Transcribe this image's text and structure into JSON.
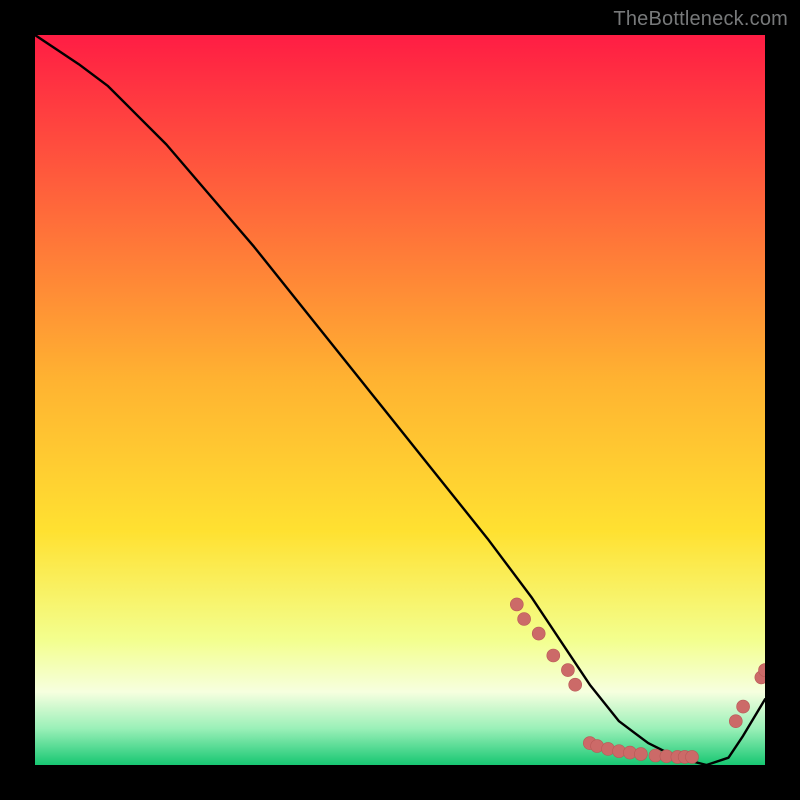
{
  "attribution": "TheBottleneck.com",
  "colors": {
    "curve": "#000000",
    "marker_fill": "#cc6a68",
    "marker_stroke": "#b85957",
    "gradient_top": "#ff1d44",
    "gradient_yellow": "#ffe131",
    "gradient_pale": "#f6ffdf",
    "gradient_green": "#2de38a",
    "gradient_bottom": "#17c772"
  },
  "chart_data": {
    "type": "line",
    "title": "",
    "xlabel": "",
    "ylabel": "",
    "xlim": [
      0,
      100
    ],
    "ylim": [
      0,
      100
    ],
    "x": [
      0,
      3,
      6,
      10,
      14,
      18,
      24,
      30,
      38,
      46,
      54,
      62,
      68,
      72,
      76,
      80,
      84,
      88,
      92,
      95,
      97,
      100
    ],
    "values": [
      100,
      98,
      96,
      93,
      89,
      85,
      78,
      71,
      61,
      51,
      41,
      31,
      23,
      17,
      11,
      6,
      3,
      1,
      0,
      1,
      4,
      9
    ],
    "markers": [
      {
        "x": 66,
        "y": 22
      },
      {
        "x": 67,
        "y": 20
      },
      {
        "x": 69,
        "y": 18
      },
      {
        "x": 71,
        "y": 15
      },
      {
        "x": 73,
        "y": 13
      },
      {
        "x": 74,
        "y": 11
      },
      {
        "x": 76,
        "y": 3
      },
      {
        "x": 77,
        "y": 2.6
      },
      {
        "x": 78.5,
        "y": 2.2
      },
      {
        "x": 80,
        "y": 1.9
      },
      {
        "x": 81.5,
        "y": 1.7
      },
      {
        "x": 83,
        "y": 1.5
      },
      {
        "x": 85,
        "y": 1.3
      },
      {
        "x": 86.5,
        "y": 1.2
      },
      {
        "x": 88,
        "y": 1.1
      },
      {
        "x": 89,
        "y": 1.1
      },
      {
        "x": 90,
        "y": 1.1
      },
      {
        "x": 96,
        "y": 6
      },
      {
        "x": 97,
        "y": 8
      },
      {
        "x": 99.5,
        "y": 12
      },
      {
        "x": 100,
        "y": 13
      }
    ]
  }
}
